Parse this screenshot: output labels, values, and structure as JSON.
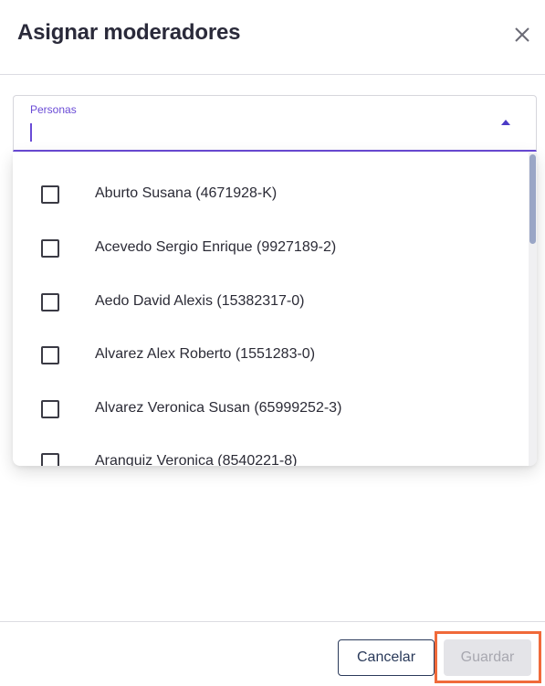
{
  "dialog": {
    "title": "Asignar moderadores",
    "close_icon": "close-icon"
  },
  "select": {
    "label": "Personas",
    "arrow_icon": "caret-up-icon",
    "value": ""
  },
  "options": [
    {
      "label": "Aburto Susana (4671928-K)",
      "checked": false
    },
    {
      "label": "Acevedo Sergio Enrique (9927189-2)",
      "checked": false
    },
    {
      "label": "Aedo David Alexis (15382317-0)",
      "checked": false
    },
    {
      "label": "Alvarez Alex Roberto (1551283-0)",
      "checked": false
    },
    {
      "label": "Alvarez Veronica Susan (65999252-3)",
      "checked": false
    },
    {
      "label": "Aranguiz Veronica (8540221-8)",
      "checked": false
    }
  ],
  "footer": {
    "cancel_label": "Cancelar",
    "save_label": "Guardar",
    "save_enabled": false
  },
  "colors": {
    "accent": "#6a4bd6",
    "highlight": "#f06a3a"
  }
}
